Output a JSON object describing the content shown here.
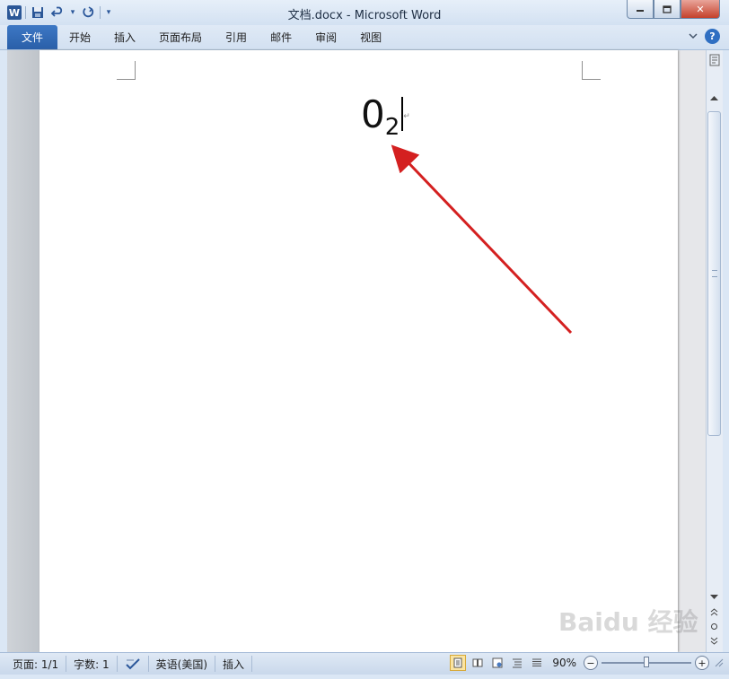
{
  "window": {
    "title": "文档.docx  -  Microsoft Word",
    "app_logo": "W",
    "controls": {
      "minimize": "▭",
      "maximize": "□",
      "close": "✕"
    }
  },
  "qat": {
    "save_icon": "💾",
    "undo_icon": "↶",
    "undo_dropdown": "▾",
    "redo_icon": "↻",
    "customize": "▾"
  },
  "ribbon": {
    "file_tab": "文件",
    "tabs": [
      "开始",
      "插入",
      "页面布局",
      "引用",
      "邮件",
      "审阅",
      "视图"
    ],
    "collapse_icon": "♡",
    "help_icon": "?"
  },
  "document": {
    "base_text": "0",
    "subscript_text": "2",
    "paragraph_mark": "↵"
  },
  "status": {
    "page": "页面: 1/1",
    "words": "字数: 1",
    "language": "英语(美国)",
    "mode": "插入",
    "zoom": "90%",
    "zoom_level_fraction": 0.5,
    "zoom_minus": "−",
    "zoom_plus": "+"
  },
  "watermark": "Baidu 经验",
  "colors": {
    "accent": "#2b5797",
    "arrow": "#d42020",
    "file_tab": "#2a5fa8"
  }
}
